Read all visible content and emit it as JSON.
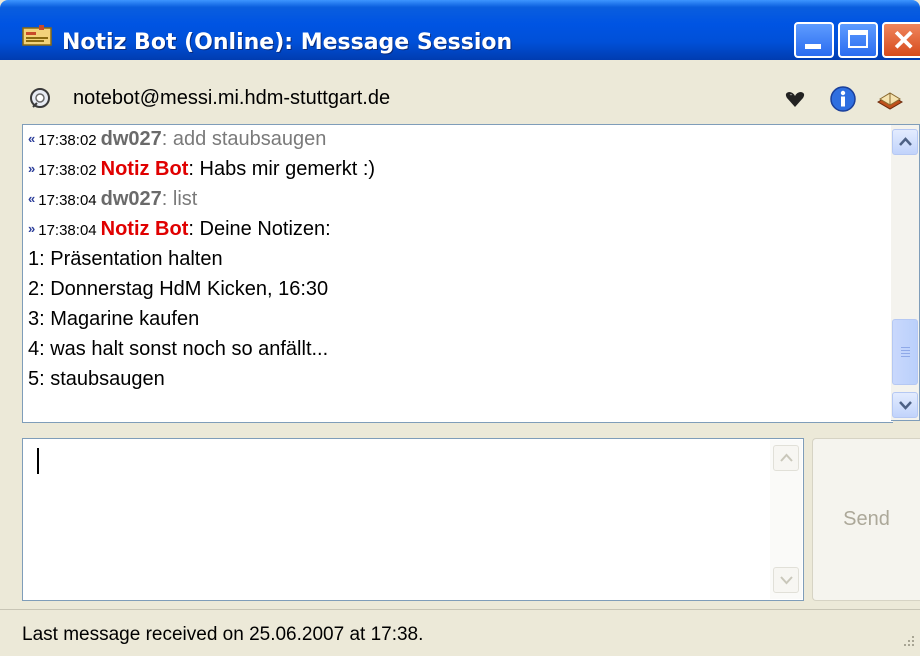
{
  "window": {
    "title": "Notiz Bot (Online): Message Session",
    "app_icon": "msn-message-icon",
    "controls": [
      "minimize",
      "maximize",
      "close"
    ]
  },
  "contact": {
    "address": "notebot@messi.mi.hdm-stuttgart.de",
    "status_icon": "contact-status-icon",
    "tools": [
      "heart-icon",
      "info-icon",
      "book-icon"
    ]
  },
  "chat": {
    "messages": [
      {
        "direction": "in",
        "time": "17:38:02",
        "nick": "dw027",
        "text": ": add staubsaugen"
      },
      {
        "direction": "out",
        "time": "17:38:02",
        "nick": "Notiz Bot",
        "text": ": Habs mir gemerkt :)"
      },
      {
        "direction": "in",
        "time": "17:38:04",
        "nick": "dw027",
        "text": ": list"
      },
      {
        "direction": "out",
        "time": "17:38:04",
        "nick": "Notiz Bot",
        "text": ": Deine Notizen:"
      }
    ],
    "notes": [
      "1: Präsentation halten",
      "2: Donnerstag HdM Kicken, 16:30",
      "3: Magarine kaufen",
      "4: was halt sonst noch so anfällt...",
      "5: staubsaugen"
    ],
    "colors": {
      "bot_nick": "#e00000",
      "user_nick": "#6a6a6a"
    }
  },
  "input": {
    "value": "",
    "send_label": "Send"
  },
  "status": {
    "text": "Last message received on 25.06.2007 at 17:38."
  }
}
